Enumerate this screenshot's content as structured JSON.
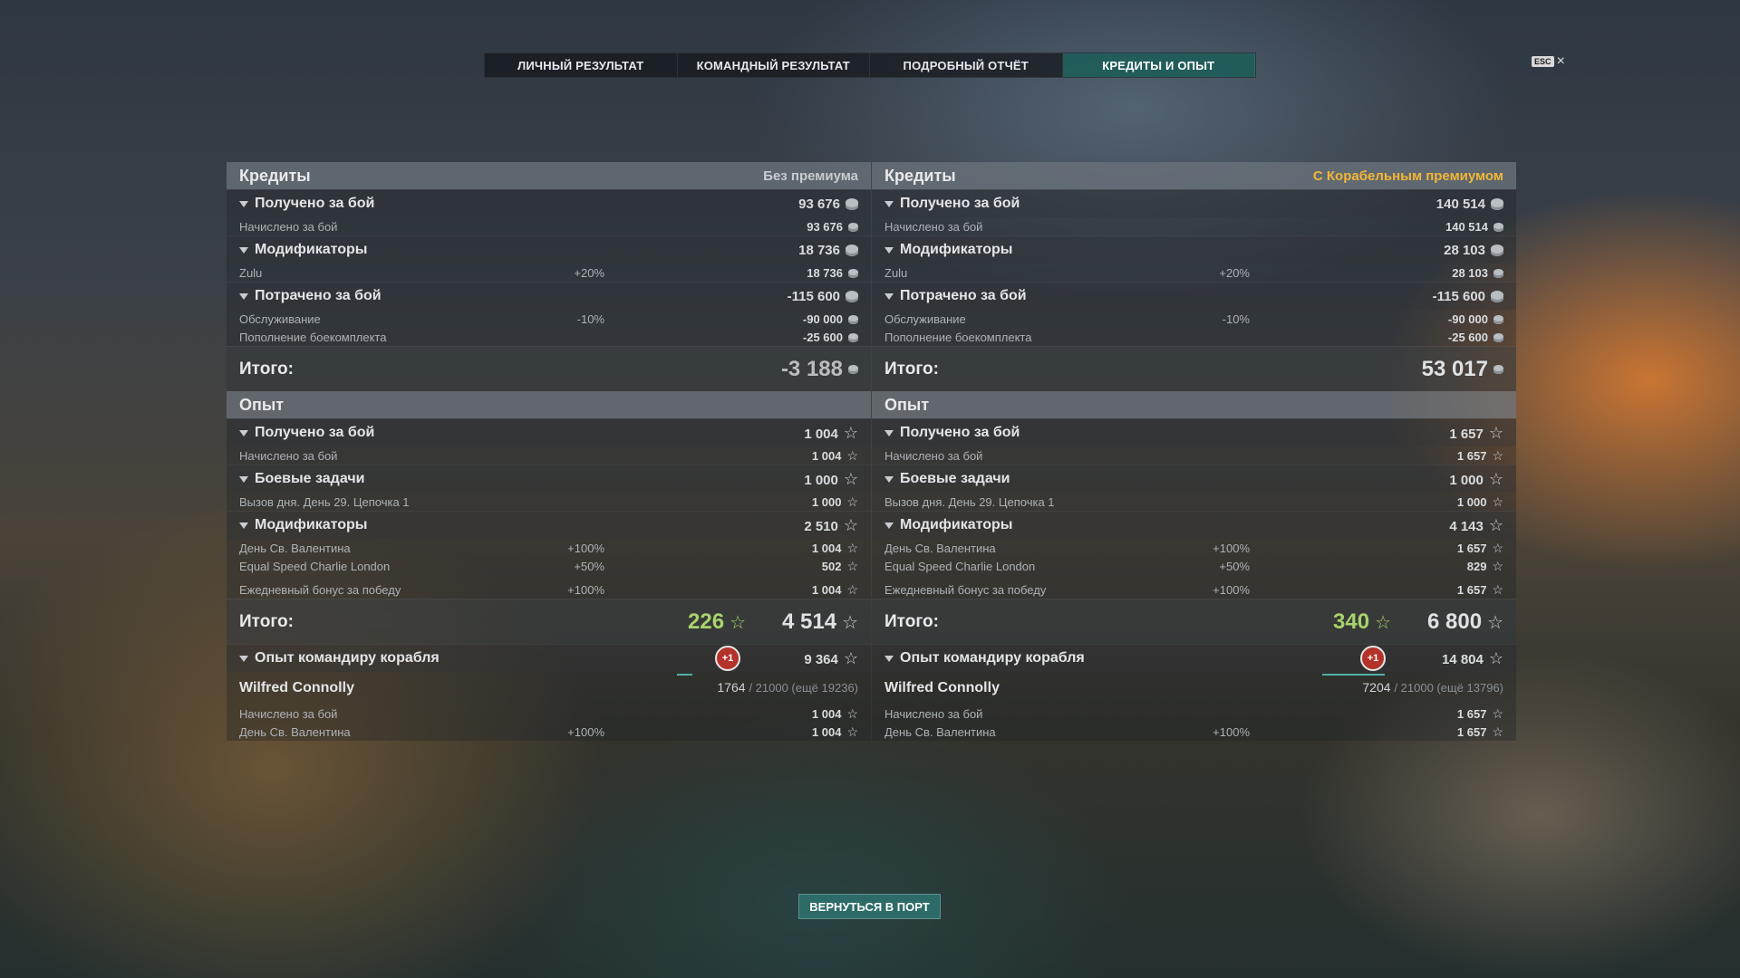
{
  "tabs": [
    "ЛИЧНЫЙ РЕЗУЛЬТАТ",
    "КОМАНДНЫЙ РЕЗУЛЬТАТ",
    "ПОДРОБНЫЙ ОТЧЁТ",
    "КРЕДИТЫ И ОПЫТ"
  ],
  "active_tab": "КРЕДИТЫ И ОПЫТ",
  "esc_label": "ESC",
  "close_label": "×",
  "back_button": "ВЕРНУТЬСЯ В ПОРТ",
  "accent_color": "#2c6e6a",
  "premium_color": "#f2b637",
  "icons": {
    "credit": "credit-coin-icon",
    "xp": "star-icon",
    "caret": "caret-down-icon"
  },
  "left": {
    "credits_title": "Кредиты",
    "credits_sub": "Без премиума",
    "earned": {
      "label": "Получено за бой",
      "value": "93 676",
      "rows": [
        {
          "label": "Начислено за бой",
          "value": "93 676"
        }
      ]
    },
    "modifiers": {
      "label": "Модификаторы",
      "value": "18 736",
      "rows": [
        {
          "label": "Zulu",
          "pct": "+20%",
          "value": "18 736"
        }
      ]
    },
    "spent": {
      "label": "Потрачено за бой",
      "value": "-115 600",
      "rows": [
        {
          "label": "Обслуживание",
          "pct": "-10%",
          "value": "-90 000"
        },
        {
          "label": "Пополнение боекомплекта",
          "value": "-25 600"
        }
      ]
    },
    "credits_total_label": "Итого:",
    "credits_total": "-3 188",
    "xp_title": "Опыт",
    "xp_earned": {
      "label": "Получено за бой",
      "value": "1 004",
      "rows": [
        {
          "label": "Начислено за бой",
          "value": "1 004"
        }
      ]
    },
    "xp_tasks": {
      "label": "Боевые задачи",
      "value": "1 000",
      "rows": [
        {
          "label": "Вызов дня. День 29. Цепочка 1",
          "value": "1 000"
        }
      ]
    },
    "xp_modifiers": {
      "label": "Модификаторы",
      "value": "2 510",
      "rows": [
        {
          "label": "День Св. Валентина",
          "pct": "+100%",
          "value": "1 004"
        },
        {
          "label": "Equal Speed Charlie London",
          "pct": "+50%",
          "value": "502"
        },
        {
          "label": "Ежедневный бонус за победу",
          "pct": "+100%",
          "value": "1 004"
        }
      ]
    },
    "xp_total_label": "Итого:",
    "xp_total_free": "226",
    "xp_total": "4 514",
    "commander": {
      "label": "Опыт командиру корабля",
      "badge": "+1",
      "value": "9 364",
      "name": "Wilfred Connolly",
      "progress_current": "1764",
      "progress_rest": "/ 21000 (ещё 19236)",
      "progress_fraction": 0.084,
      "rows": [
        {
          "label": "Начислено за бой",
          "value": "1 004"
        },
        {
          "label": "День Св. Валентина",
          "pct": "+100%",
          "value": "1 004"
        }
      ]
    }
  },
  "right": {
    "credits_title": "Кредиты",
    "credits_sub": "С Корабельным премиумом",
    "earned": {
      "label": "Получено за бой",
      "value": "140 514",
      "rows": [
        {
          "label": "Начислено за бой",
          "value": "140 514"
        }
      ]
    },
    "modifiers": {
      "label": "Модификаторы",
      "value": "28 103",
      "rows": [
        {
          "label": "Zulu",
          "pct": "+20%",
          "value": "28 103"
        }
      ]
    },
    "spent": {
      "label": "Потрачено за бой",
      "value": "-115 600",
      "rows": [
        {
          "label": "Обслуживание",
          "pct": "-10%",
          "value": "-90 000"
        },
        {
          "label": "Пополнение боекомплекта",
          "value": "-25 600"
        }
      ]
    },
    "credits_total_label": "Итого:",
    "credits_total": "53 017",
    "xp_title": "Опыт",
    "xp_earned": {
      "label": "Получено за бой",
      "value": "1 657",
      "rows": [
        {
          "label": "Начислено за бой",
          "value": "1 657"
        }
      ]
    },
    "xp_tasks": {
      "label": "Боевые задачи",
      "value": "1 000",
      "rows": [
        {
          "label": "Вызов дня. День 29. Цепочка 1",
          "value": "1 000"
        }
      ]
    },
    "xp_modifiers": {
      "label": "Модификаторы",
      "value": "4 143",
      "rows": [
        {
          "label": "День Св. Валентина",
          "pct": "+100%",
          "value": "1 657"
        },
        {
          "label": "Equal Speed Charlie London",
          "pct": "+50%",
          "value": "829"
        },
        {
          "label": "Ежедневный бонус за победу",
          "pct": "+100%",
          "value": "1 657"
        }
      ]
    },
    "xp_total_label": "Итого:",
    "xp_total_free": "340",
    "xp_total": "6 800",
    "commander": {
      "label": "Опыт командиру корабля",
      "badge": "+1",
      "value": "14 804",
      "name": "Wilfred Connolly",
      "progress_current": "7204",
      "progress_rest": "/ 21000 (ещё 13796)",
      "progress_fraction": 0.343,
      "rows": [
        {
          "label": "Начислено за бой",
          "value": "1 657"
        },
        {
          "label": "День Св. Валентина",
          "pct": "+100%",
          "value": "1 657"
        }
      ]
    }
  }
}
